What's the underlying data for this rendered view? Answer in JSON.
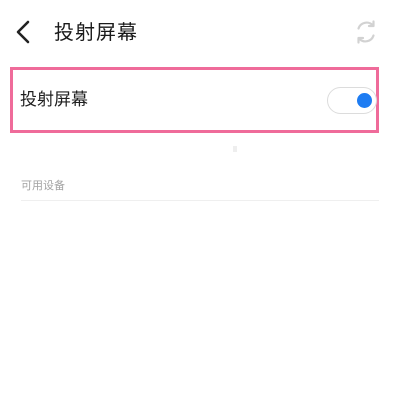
{
  "header": {
    "back_icon": "chevron-left-icon",
    "title": "投射屏幕",
    "refresh_icon": "refresh-icon"
  },
  "settings": {
    "cast_screen": {
      "label": "投射屏幕",
      "enabled": true
    }
  },
  "devices_section": {
    "title": "可用设备"
  },
  "colors": {
    "highlight_border": "#ef6b9a",
    "toggle_accent": "#1e7cf2",
    "section_text": "#a3a3a3"
  }
}
